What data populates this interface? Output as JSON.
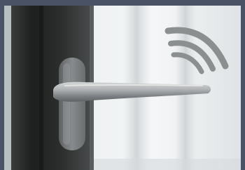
{
  "image": {
    "subject": "door-handle-with-wireless-signal",
    "icon": "wireless-signal-icon",
    "colors": {
      "border": "#4a5366",
      "background_light": "#f2f4f5",
      "background_mid": "#d8dde0",
      "door_frame": "#2b2d2d",
      "door_frame_highlight": "#4a4d4d",
      "handle_plate": "#777b7d",
      "handle_lever": "#a6aaac",
      "signal_arcs": "#8c8f90"
    }
  }
}
